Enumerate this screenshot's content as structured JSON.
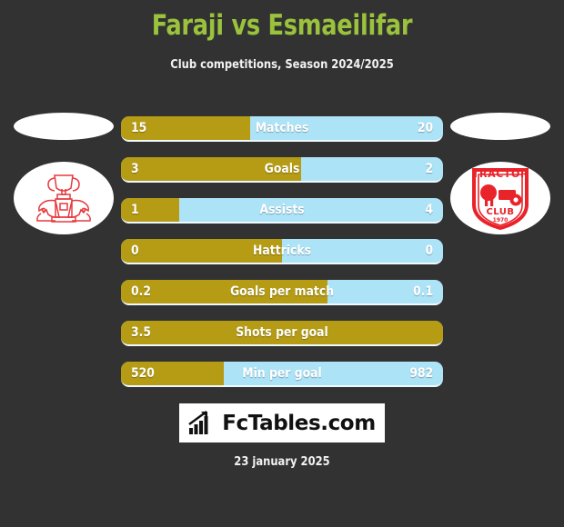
{
  "header": {
    "title": "Faraji vs Esmaeilifar",
    "subtitle": "Club competitions, Season 2024/2025",
    "title_color": "#9ac23c"
  },
  "teams": {
    "home": {
      "badge_name": "home-club-crest",
      "crest_color": "#e8383d"
    },
    "away": {
      "badge_name": "tractor-club-crest",
      "crest_color": "#e8232a",
      "crest_text_top": "TRACTOR",
      "crest_text_mid": "CLUB",
      "crest_text_year": "1970"
    }
  },
  "colors": {
    "background": "#323232",
    "home_bar": "#b59c14",
    "away_bar": "#ade3f7",
    "text": "#ffffff"
  },
  "chart_data": {
    "type": "bar",
    "title": "Faraji vs Esmaeilifar",
    "subtitle": "Club competitions, Season 2024/2025",
    "orientation": "horizontal-paired",
    "series": [
      {
        "name": "Faraji",
        "color": "#b59c14"
      },
      {
        "name": "Esmaeilifar",
        "color": "#ade3f7"
      }
    ],
    "categories": [
      "Matches",
      "Goals",
      "Assists",
      "Hattricks",
      "Goals per match",
      "Shots per goal",
      "Min per goal"
    ],
    "rows": [
      {
        "label": "Matches",
        "home": "15",
        "away": "20",
        "home_pct": 40
      },
      {
        "label": "Goals",
        "home": "3",
        "away": "2",
        "home_pct": 56
      },
      {
        "label": "Assists",
        "home": "1",
        "away": "4",
        "home_pct": 18
      },
      {
        "label": "Hattricks",
        "home": "0",
        "away": "0",
        "home_pct": 50
      },
      {
        "label": "Goals per match",
        "home": "0.2",
        "away": "0.1",
        "home_pct": 64
      },
      {
        "label": "Shots per goal",
        "home": "3.5",
        "away": "",
        "home_pct": 100
      },
      {
        "label": "Min per goal",
        "home": "520",
        "away": "982",
        "home_pct": 32
      }
    ]
  },
  "footer": {
    "logo_text": "FcTables.com",
    "logo_icon": "bar-chart-icon",
    "date": "23 january 2025"
  }
}
